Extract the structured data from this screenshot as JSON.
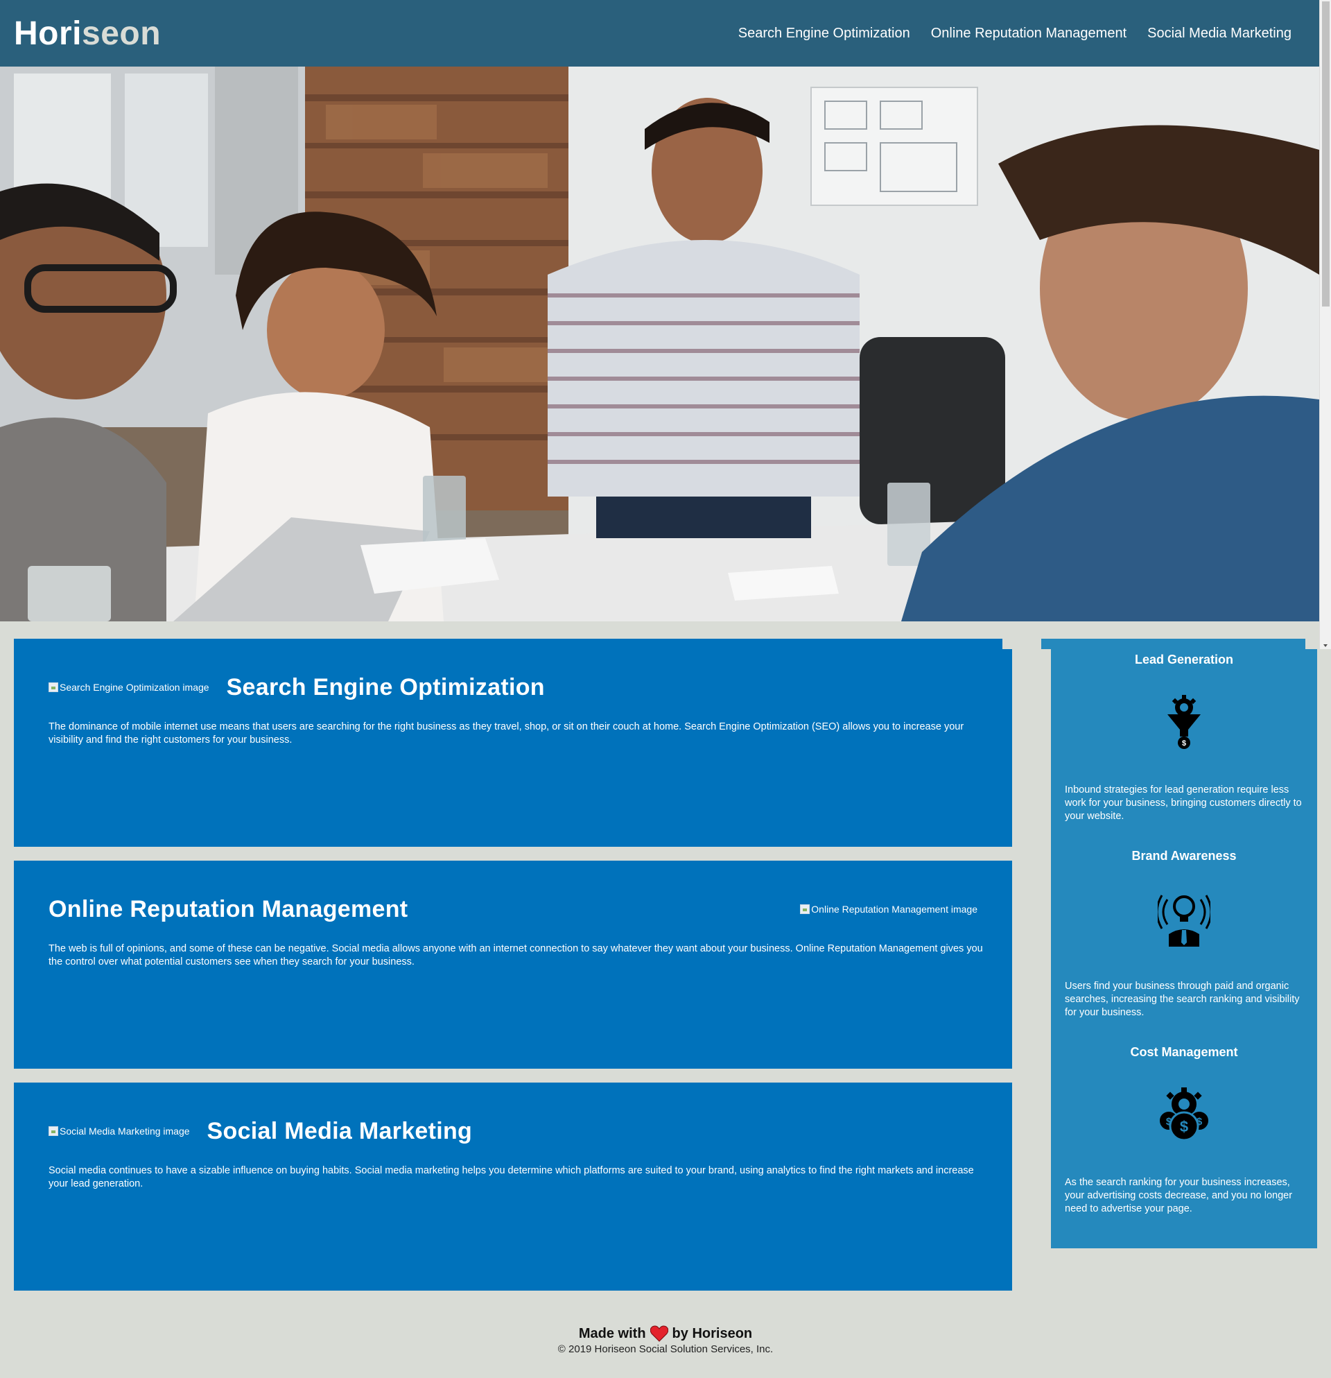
{
  "header": {
    "logo_main": "Hori",
    "logo_accent": "seon",
    "nav": [
      {
        "label": "Search Engine Optimization"
      },
      {
        "label": "Online Reputation Management"
      },
      {
        "label": "Social Media Marketing"
      }
    ]
  },
  "cards": {
    "seo": {
      "img_alt": "Search Engine Optimization image",
      "title": "Search Engine Optimization",
      "body": "The dominance of mobile internet use means that users are searching for the right business as they travel, shop, or sit on their couch at home. Search Engine Optimization (SEO) allows you to increase your visibility and find the right customers for your business."
    },
    "orm": {
      "img_alt": "Online Reputation Management image",
      "title": "Online Reputation Management",
      "body": "The web is full of opinions, and some of these can be negative. Social media allows anyone with an internet connection to say whatever they want about your business. Online Reputation Management gives you the control over what potential customers see when they search for your business."
    },
    "smm": {
      "img_alt": "Social Media Marketing image",
      "title": "Social Media Marketing",
      "body": "Social media continues to have a sizable influence on buying habits. Social media marketing helps you determine which platforms are suited to your brand, using analytics to find the right markets and increase your lead generation."
    }
  },
  "benefits": [
    {
      "title": "Lead Generation",
      "icon": "lead-generation-icon",
      "body": "Inbound strategies for lead generation require less work for your business, bringing customers directly to your website."
    },
    {
      "title": "Brand Awareness",
      "icon": "brand-awareness-icon",
      "body": "Users find your business through paid and organic searches, increasing the search ranking and visibility for your business."
    },
    {
      "title": "Cost Management",
      "icon": "cost-management-icon",
      "body": "As the search ranking for your business increases, your advertising costs decrease, and you no longer need to advertise your page."
    }
  ],
  "footer": {
    "made_prefix": "Made with",
    "made_suffix": "by Horiseon",
    "copyright": "© 2019 Horiseon Social Solution Services, Inc."
  },
  "colors": {
    "header_bg": "#2a607c",
    "page_bg": "#d9dcd6",
    "card_bg": "#0072bb",
    "sidebar_bg": "#2589bd",
    "heart": "#e3222c"
  }
}
